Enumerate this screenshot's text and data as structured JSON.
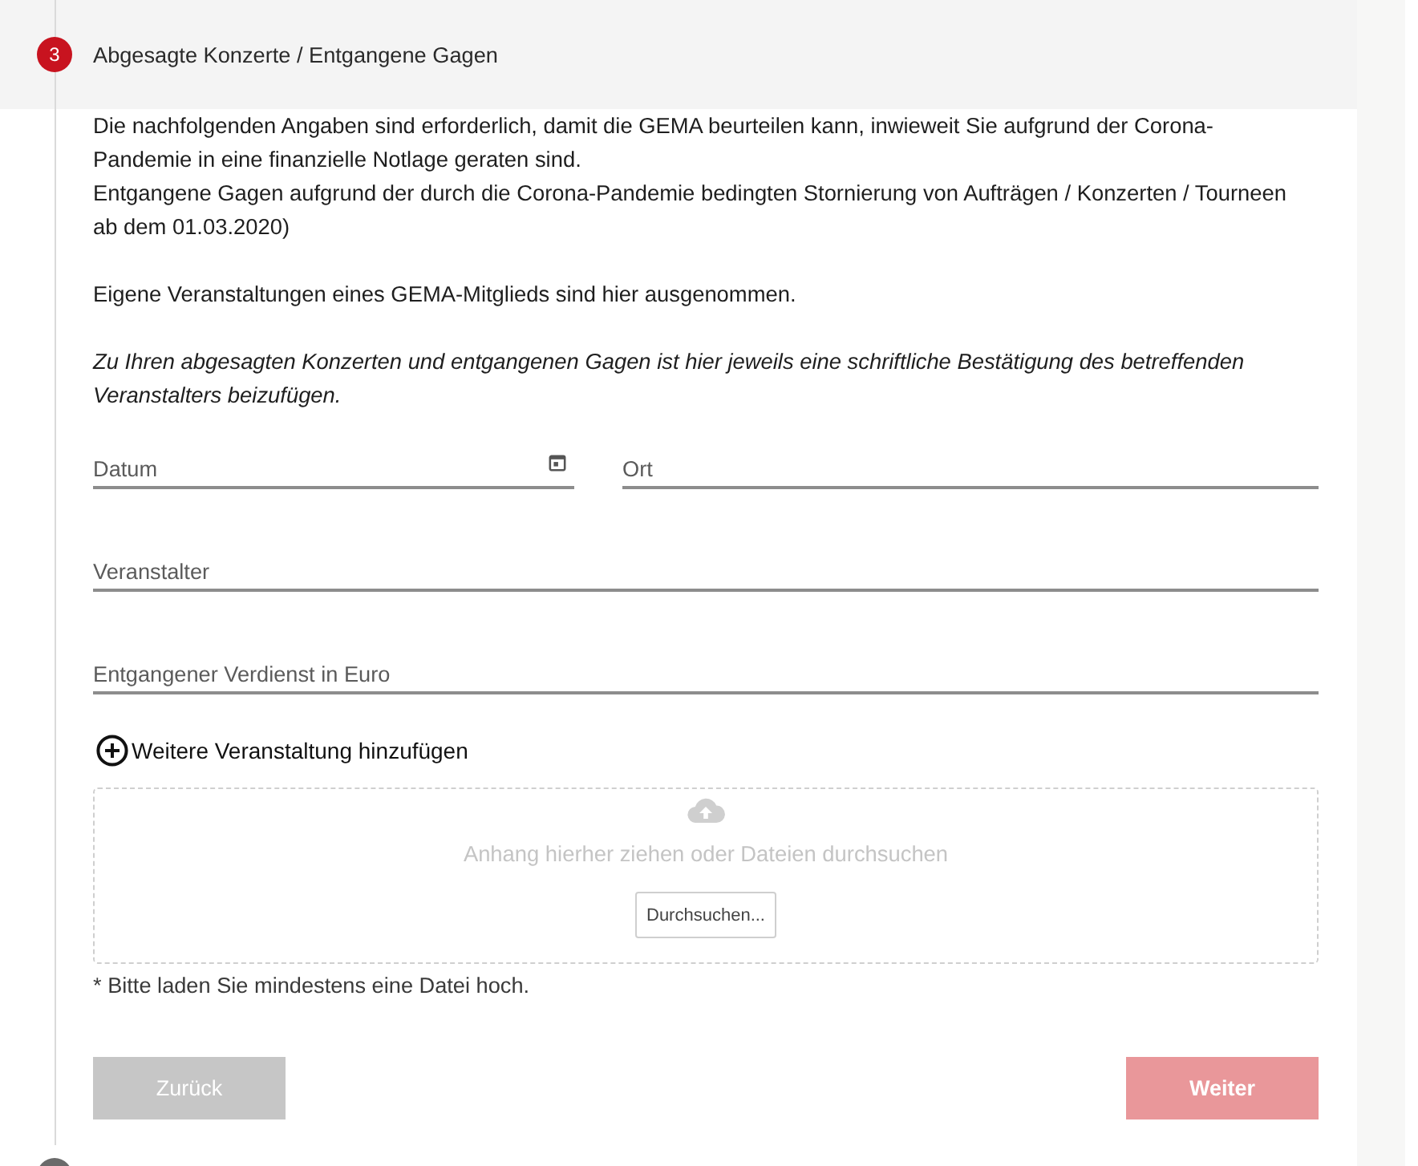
{
  "steps": [
    {
      "number": "3",
      "title": "Abgesagte Konzerte / Entgangene Gagen",
      "active": true
    },
    {
      "active": false
    }
  ],
  "paragraphs": [
    {
      "kind": "plain",
      "lines": [
        "Die nachfolgenden Angaben sind erforderlich, damit die GEMA beurteilen kann, inwieweit Sie aufgrund der Corona-Pandemie in eine finanzielle Notlage geraten sind.",
        "Entgangene Gagen aufgrund der durch die Corona-Pandemie bedingten Stornierung von Aufträgen / Konzerten / Tourneen ab dem 01.03.2020)"
      ]
    },
    {
      "kind": "plain",
      "lines": [
        "Eigene Veranstaltungen eines GEMA-Mitglieds sind hier ausgenommen."
      ]
    },
    {
      "kind": "emphasis",
      "lines": [
        "Zu Ihren abgesagten Konzerten und entgangenen Gagen ist hier jeweils eine schriftliche Bestätigung des betreffenden Veranstalters beizufügen."
      ]
    }
  ],
  "field_rows": [
    {
      "fields": [
        {
          "placeholder": "Datum",
          "kind": "date"
        },
        {
          "placeholder": "Ort",
          "kind": "text"
        }
      ]
    },
    {
      "fields": [
        {
          "placeholder": "Veranstalter",
          "kind": "text"
        }
      ]
    },
    {
      "fields": [
        {
          "placeholder": "Entgangener Verdienst in Euro",
          "kind": "text"
        }
      ]
    }
  ],
  "add_link": {
    "label": "Weitere Veranstaltung hinzufügen"
  },
  "upload": {
    "hint": "Anhang hierher ziehen oder Dateien durchsuchen",
    "browse_button": "Durchsuchen...",
    "note": "* Bitte laden Sie mindestens eine Datei hoch."
  },
  "buttons": [
    {
      "label": "Zurück",
      "kind": "back",
      "disabled": true
    },
    {
      "label": "Weiter",
      "kind": "next",
      "disabled": true
    }
  ]
}
